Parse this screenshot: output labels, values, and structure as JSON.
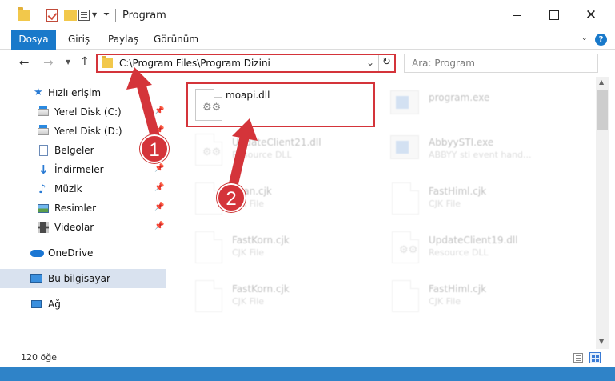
{
  "window": {
    "title": "Program",
    "close_glyph": "✕"
  },
  "ribbon": {
    "tabs": [
      "Dosya",
      "Giriş",
      "Paylaş",
      "Görünüm"
    ],
    "help": "?"
  },
  "address_bar": {
    "path": "C:\\Program Files\\Program Dizini",
    "highlight_color": "#d4343a"
  },
  "search": {
    "placeholder": "Ara: Program"
  },
  "sidebar": {
    "items": [
      {
        "label": "Hızlı erişim",
        "icon": "star-icon"
      },
      {
        "label": "Yerel Disk (C:)",
        "icon": "drive-icon"
      },
      {
        "label": "Yerel Disk (D:)",
        "icon": "drive-icon"
      },
      {
        "label": "Belgeler",
        "icon": "documents-icon"
      },
      {
        "label": "İndirmeler",
        "icon": "download-icon"
      },
      {
        "label": "Müzik",
        "icon": "music-icon"
      },
      {
        "label": "Resimler",
        "icon": "pictures-icon"
      },
      {
        "label": "Videolar",
        "icon": "videos-icon"
      },
      {
        "label": "OneDrive",
        "icon": "cloud-icon"
      },
      {
        "label": "Bu bilgisayar",
        "icon": "computer-icon"
      },
      {
        "label": "Ağ",
        "icon": "network-icon"
      }
    ]
  },
  "files": [
    {
      "name": "moapi.dll",
      "desc": ""
    },
    {
      "name": "program.exe",
      "desc": ""
    },
    {
      "name": "UpdateClient21.dll",
      "desc": "Resource DLL"
    },
    {
      "name": "AbbyySTI.exe",
      "desc": "ABBYY sti event hand..."
    },
    {
      "name": "Scan.cjk",
      "desc": "CJK File"
    },
    {
      "name": "FastHiml.cjk",
      "desc": "CJK File"
    },
    {
      "name": "FastKorn.cjk",
      "desc": "CJK File"
    },
    {
      "name": "UpdateClient19.dll",
      "desc": "Resource DLL"
    },
    {
      "name": "FastKorn.cjk",
      "desc": "CJK File"
    },
    {
      "name": "FastHiml.cjk",
      "desc": "CJK File"
    }
  ],
  "status": {
    "item_count": "120 öğe"
  },
  "annotations": {
    "step1": "1",
    "step2": "2",
    "color": "#d4343a"
  }
}
